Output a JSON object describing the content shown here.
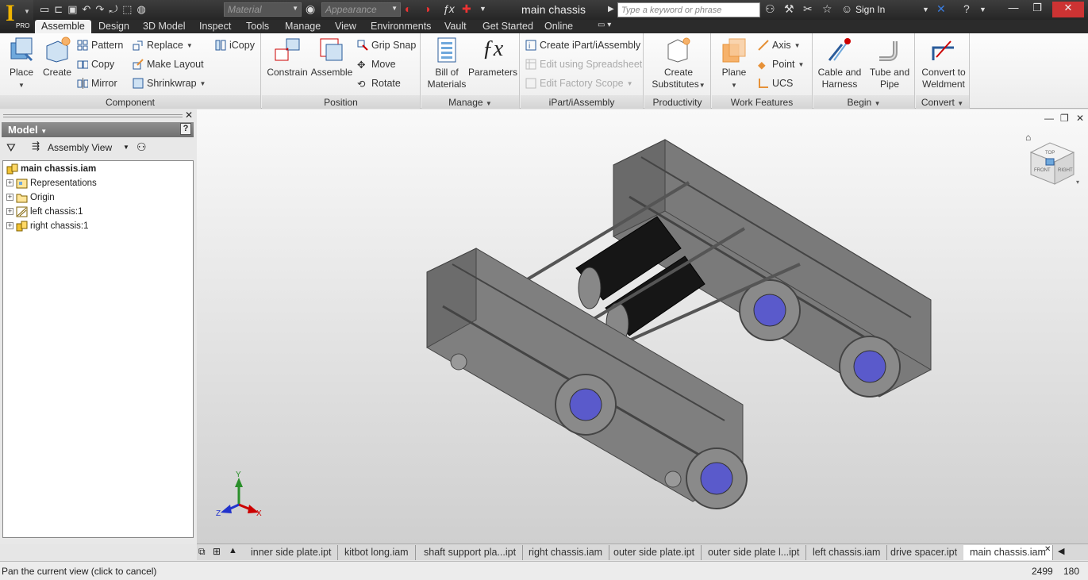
{
  "titlebar": {
    "logo_text": "I",
    "logo_badge": "PRO",
    "material_placeholder": "Material",
    "appearance_placeholder": "Appearance",
    "document_title": "main chassis",
    "search_placeholder": "Type a keyword or phrase",
    "sign_in": "Sign In"
  },
  "ribbon_tabs": [
    "Assemble",
    "Design",
    "3D Model",
    "Inspect",
    "Tools",
    "Manage",
    "View",
    "Environments",
    "Vault",
    "Get Started",
    "Online"
  ],
  "ribbon": {
    "component": {
      "title": "Component",
      "place": "Place",
      "create": "Create",
      "pattern": "Pattern",
      "copy": "Copy",
      "mirror": "Mirror",
      "replace": "Replace",
      "make_layout": "Make Layout",
      "shrinkwrap": "Shrinkwrap",
      "icopy": "iCopy"
    },
    "position": {
      "title": "Position",
      "constrain": "Constrain",
      "assemble": "Assemble",
      "grip_snap": "Grip Snap",
      "move": "Move",
      "rotate": "Rotate"
    },
    "manage": {
      "title": "Manage",
      "bom_line1": "Bill of",
      "bom_line2": "Materials",
      "parameters": "Parameters"
    },
    "ipart": {
      "title": "iPart/iAssembly",
      "create": "Create iPart/iAssembly",
      "edit_spreadsheet": "Edit using Spreadsheet",
      "edit_factory": "Edit Factory Scope"
    },
    "productivity": {
      "title": "Productivity",
      "line1": "Create",
      "line2": "Substitutes"
    },
    "work_features": {
      "title": "Work Features",
      "plane": "Plane",
      "axis": "Axis",
      "point": "Point",
      "ucs": "UCS"
    },
    "begin": {
      "title": "Begin",
      "cable_line1": "Cable and",
      "cable_line2": "Harness",
      "tube_line1": "Tube and",
      "tube_line2": "Pipe"
    },
    "convert": {
      "title": "Convert",
      "line1": "Convert to",
      "line2": "Weldment"
    }
  },
  "browser": {
    "header": "Model",
    "view": "Assembly View",
    "tree": [
      {
        "label": "main chassis.iam"
      },
      {
        "label": "Representations"
      },
      {
        "label": "Origin"
      },
      {
        "label": "left chassis:1"
      },
      {
        "label": "right chassis:1"
      }
    ]
  },
  "viewcube": {
    "top": "TOP",
    "front": "FRONT",
    "right": "RIGHT"
  },
  "axes": {
    "x": "X",
    "y": "Y",
    "z": "Z"
  },
  "doc_tabs": [
    "inner side plate.ipt",
    "kitbot long.iam",
    "shaft support pla...ipt",
    "right chassis.iam",
    "outer side plate.ipt",
    "outer side plate l...ipt",
    "left chassis.iam",
    "drive spacer.ipt",
    "main chassis.iam"
  ],
  "status": {
    "text": "Pan the current view (click to cancel)",
    "value_a": "2499",
    "value_b": "180"
  },
  "colors": {
    "titlebar": "#2e2e2e",
    "chassis": "#6e6e6e",
    "motor": "#161616",
    "wheel_hub": "#5a5acb"
  }
}
